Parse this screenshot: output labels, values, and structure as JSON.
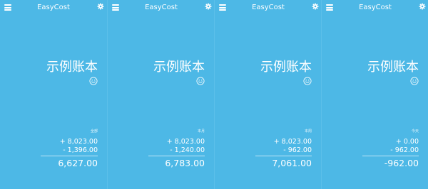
{
  "app": {
    "title": "EasyCost"
  },
  "book": {
    "name": "示例账本"
  },
  "icons": [
    "menu-icon",
    "gear-icon",
    "smiley-icon"
  ],
  "screens": [
    {
      "period_label": "全部",
      "income": "+ 8,023.00",
      "expense": "- 1,396.00",
      "balance": "6,627.00"
    },
    {
      "period_label": "本月",
      "income": "+ 8,023.00",
      "expense": "- 1,240.00",
      "balance": "6,783.00"
    },
    {
      "period_label": "本周",
      "income": "+ 8,023.00",
      "expense": "- 962.00",
      "balance": "7,061.00"
    },
    {
      "period_label": "今天",
      "income": "+ 0.00",
      "expense": "- 962.00",
      "balance": "-962.00"
    }
  ]
}
